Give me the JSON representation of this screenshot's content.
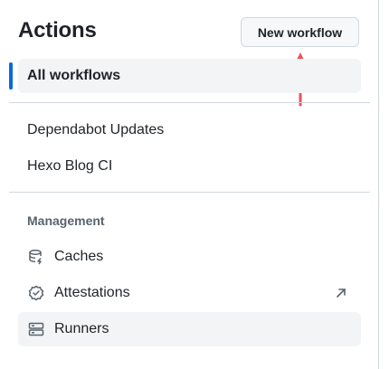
{
  "header": {
    "title": "Actions",
    "new_workflow_label": "New workflow"
  },
  "nav": {
    "all_workflows": "All workflows",
    "workflows": [
      "Dependabot Updates",
      "Hexo Blog CI"
    ]
  },
  "management": {
    "label": "Management",
    "items": [
      {
        "label": "Caches",
        "icon": "database-icon"
      },
      {
        "label": "Attestations",
        "icon": "verified-badge-icon",
        "external": true
      },
      {
        "label": "Runners",
        "icon": "server-icon"
      }
    ]
  },
  "colors": {
    "accent": "#0969da",
    "annotation_arrow": "#f0505a"
  }
}
